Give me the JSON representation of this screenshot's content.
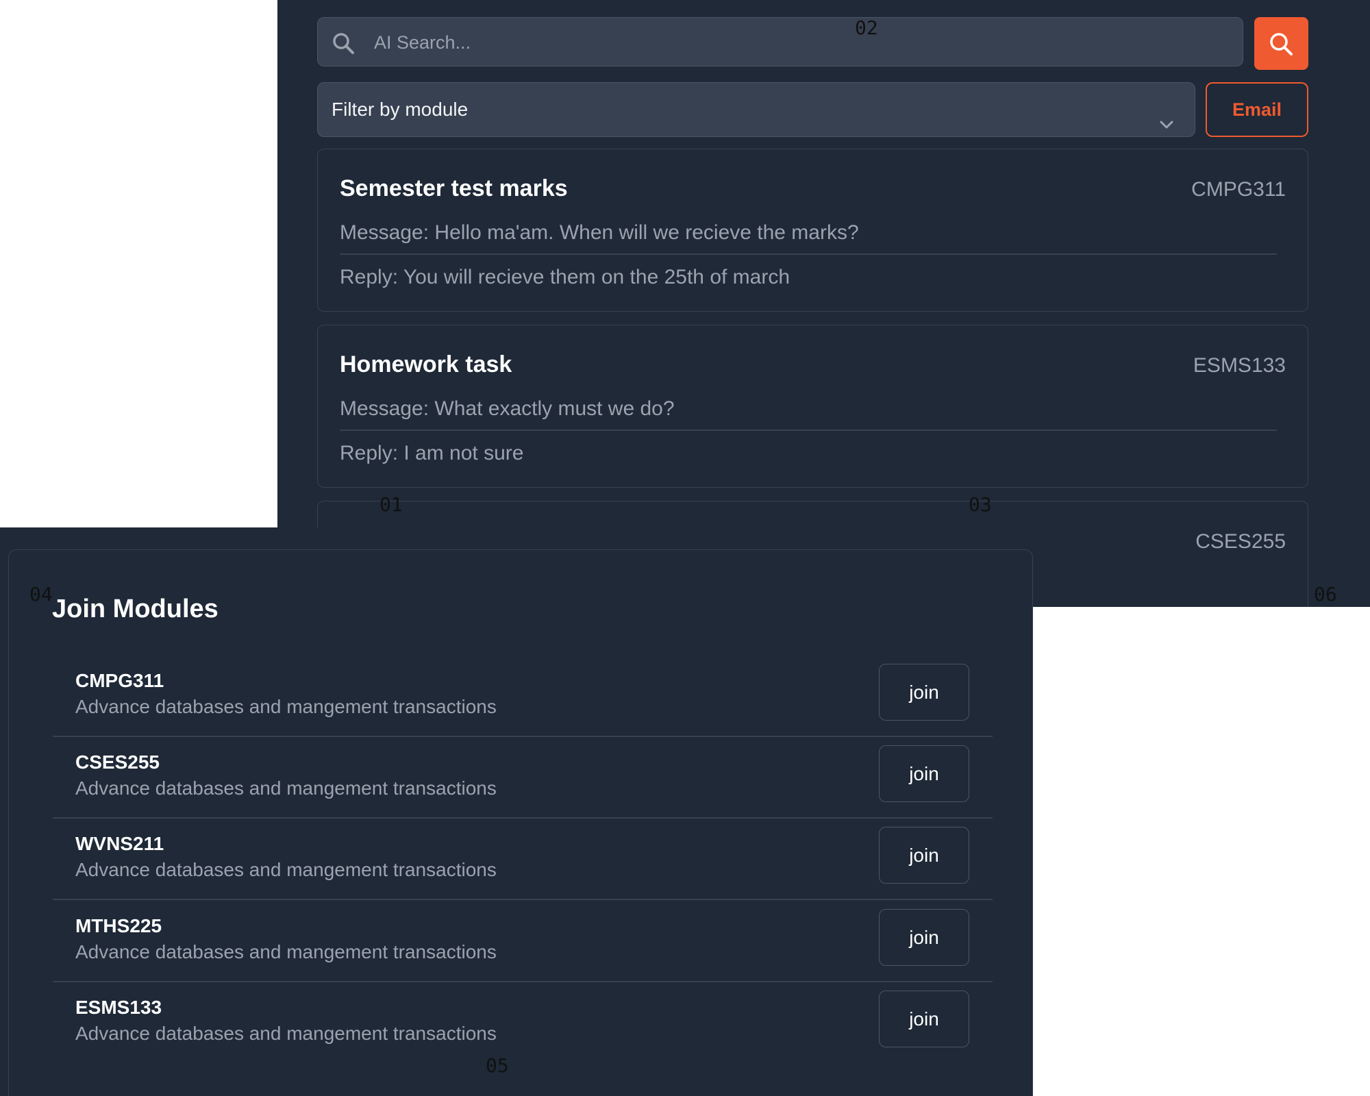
{
  "search": {
    "placeholder": "AI Search...",
    "button_icon": "search-icon"
  },
  "filter": {
    "label": "Filter by module",
    "icon": "chevron-down-icon"
  },
  "email_button": "Email",
  "colors": {
    "accent": "#f05a30",
    "panel_bg": "#1f2937",
    "field_bg": "#374151"
  },
  "messages": [
    {
      "title": "Semester test marks",
      "code": "CMPG311",
      "message": "Message: Hello ma'am. When will we recieve the marks?",
      "reply": "Reply: You will recieve them on the 25th of march"
    },
    {
      "title": "Homework task",
      "code": "ESMS133",
      "message": "Message: What exactly must we do?",
      "reply": "Reply: I am not sure"
    },
    {
      "code": "CSES255"
    }
  ],
  "join_modules": {
    "title": "Join Modules",
    "modules": [
      {
        "code": "CMPG311",
        "description": "Advance databases and mangement transactions",
        "button": "join"
      },
      {
        "code": "CSES255",
        "description": "Advance databases and mangement transactions",
        "button": "join"
      },
      {
        "code": "WVNS211",
        "description": "Advance databases and mangement transactions",
        "button": "join"
      },
      {
        "code": "MTHS225",
        "description": "Advance databases and mangement transactions",
        "button": "join"
      },
      {
        "code": "ESMS133",
        "description": "Advance databases and mangement transactions",
        "button": "join"
      }
    ]
  },
  "markers": [
    "01",
    "02",
    "03",
    "04",
    "05",
    "06"
  ]
}
